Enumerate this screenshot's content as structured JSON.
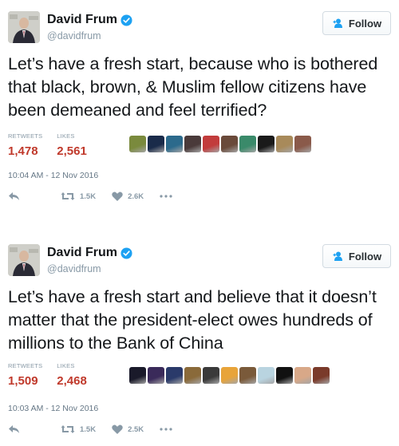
{
  "tweets": [
    {
      "author": {
        "name": "David Frum",
        "handle": "@davidfrum",
        "verified": true
      },
      "follow_label": "Follow",
      "text": "Let’s have a fresh start, because who is bothered that black, brown, & Muslim fellow citizens have been demeaned and feel terrified?",
      "stats": {
        "retweets_label": "RETWEETS",
        "retweets": "1,478",
        "likes_label": "LIKES",
        "likes": "2,561"
      },
      "timestamp": "10:04 AM - 12 Nov 2016",
      "actions": {
        "retweet_count": "1.5K",
        "like_count": "2.6K"
      },
      "liker_colors": [
        "#7a8a3d",
        "#1a2b4a",
        "#2c6a8c",
        "#4a3a3a",
        "#c23c3c",
        "#6a4a3a",
        "#3a8a6a",
        "#1a1a1a",
        "#a88a5a",
        "#8a5a4a"
      ]
    },
    {
      "author": {
        "name": "David Frum",
        "handle": "@davidfrum",
        "verified": true
      },
      "follow_label": "Follow",
      "text": "Let’s have a fresh start and believe that it doesn’t matter that the president-elect owes hundreds of millions to the Bank of China",
      "stats": {
        "retweets_label": "RETWEETS",
        "retweets": "1,509",
        "likes_label": "LIKES",
        "likes": "2,468"
      },
      "timestamp": "10:03 AM - 12 Nov 2016",
      "actions": {
        "retweet_count": "1.5K",
        "like_count": "2.5K"
      },
      "liker_colors": [
        "#1a1a2a",
        "#3a2a5a",
        "#2a3a6a",
        "#8a6a3a",
        "#3a3a3a",
        "#e8a43a",
        "#7a5a3a",
        "#b9d4e0",
        "#111111",
        "#d8a888",
        "#7a3a2a"
      ]
    }
  ],
  "colors": {
    "brand_blue": "#1da1f2",
    "stat_red": "#c0392b",
    "muted": "#8899a6"
  },
  "icons": {
    "verified": "verified-badge-icon",
    "follow": "follow-person-icon",
    "reply": "reply-icon",
    "retweet": "retweet-icon",
    "like": "heart-icon",
    "more": "more-dots-icon"
  }
}
